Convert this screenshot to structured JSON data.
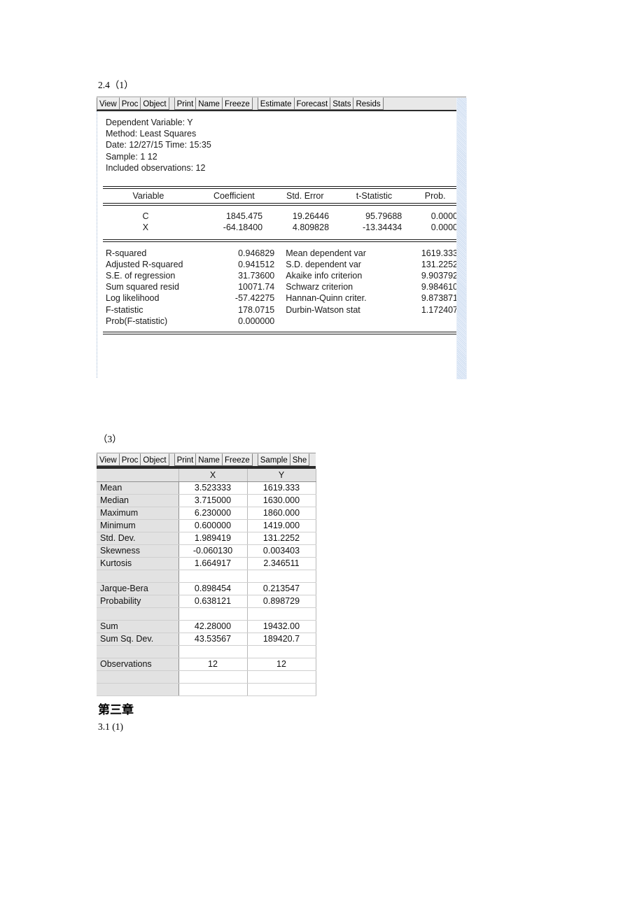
{
  "document": {
    "section_1_label": "2.4（1）",
    "section_3_label": "（3）",
    "chapter_heading": "第三章",
    "next_problem_label": "3.1 (1)"
  },
  "regression_window": {
    "toolbar": {
      "groups": [
        {
          "buttons": [
            "View",
            "Proc",
            "Object"
          ]
        },
        {
          "buttons": [
            "Print",
            "Name",
            "Freeze"
          ]
        },
        {
          "buttons": [
            "Estimate",
            "Forecast",
            "Stats",
            "Resids"
          ]
        }
      ]
    },
    "header_lines": [
      "Dependent Variable: Y",
      "Method: Least Squares",
      "Date: 12/27/15   Time: 15:35",
      "Sample: 1 12",
      "Included observations: 12"
    ],
    "coefficient_table": {
      "columns": [
        "Variable",
        "Coefficient",
        "Std. Error",
        "t-Statistic",
        "Prob."
      ],
      "rows": [
        {
          "variable": "C",
          "coefficient": "1845.475",
          "std_error": "19.26446",
          "t_statistic": "95.79688",
          "prob": "0.0000"
        },
        {
          "variable": "X",
          "coefficient": "-64.18400",
          "std_error": "4.809828",
          "t_statistic": "-13.34434",
          "prob": "0.0000"
        }
      ]
    },
    "summary_stats": [
      {
        "label_left": "R-squared",
        "value_left": "0.946829",
        "label_right": "Mean dependent var",
        "value_right": "1619.333"
      },
      {
        "label_left": "Adjusted R-squared",
        "value_left": "0.941512",
        "label_right": "S.D. dependent var",
        "value_right": "131.2252"
      },
      {
        "label_left": "S.E. of regression",
        "value_left": "31.73600",
        "label_right": "Akaike info criterion",
        "value_right": "9.903792"
      },
      {
        "label_left": "Sum squared resid",
        "value_left": "10071.74",
        "label_right": "Schwarz criterion",
        "value_right": "9.984610"
      },
      {
        "label_left": "Log likelihood",
        "value_left": "-57.42275",
        "label_right": "Hannan-Quinn criter.",
        "value_right": "9.873871"
      },
      {
        "label_left": "F-statistic",
        "value_left": "178.0715",
        "label_right": "Durbin-Watson stat",
        "value_right": "1.172407"
      },
      {
        "label_left": "Prob(F-statistic)",
        "value_left": "0.000000",
        "label_right": "",
        "value_right": ""
      }
    ]
  },
  "descriptive_window": {
    "toolbar": {
      "groups": [
        {
          "buttons": [
            "View",
            "Proc",
            "Object"
          ]
        },
        {
          "buttons": [
            "Print",
            "Name",
            "Freeze"
          ]
        },
        {
          "buttons": [
            "Sample",
            "She"
          ]
        }
      ]
    },
    "table": {
      "columns": [
        "",
        "X",
        "Y"
      ],
      "rows": [
        {
          "label": "Mean",
          "x": "3.523333",
          "y": "1619.333",
          "blank": false
        },
        {
          "label": "Median",
          "x": "3.715000",
          "y": "1630.000",
          "blank": false
        },
        {
          "label": "Maximum",
          "x": "6.230000",
          "y": "1860.000",
          "blank": false
        },
        {
          "label": "Minimum",
          "x": "0.600000",
          "y": "1419.000",
          "blank": false
        },
        {
          "label": "Std. Dev.",
          "x": "1.989419",
          "y": "131.2252",
          "blank": false
        },
        {
          "label": "Skewness",
          "x": "-0.060130",
          "y": "0.003403",
          "blank": false
        },
        {
          "label": "Kurtosis",
          "x": "1.664917",
          "y": "2.346511",
          "blank": false
        },
        {
          "label": "",
          "x": "",
          "y": "",
          "blank": true
        },
        {
          "label": "Jarque-Bera",
          "x": "0.898454",
          "y": "0.213547",
          "blank": false
        },
        {
          "label": "Probability",
          "x": "0.638121",
          "y": "0.898729",
          "blank": false
        },
        {
          "label": "",
          "x": "",
          "y": "",
          "blank": true
        },
        {
          "label": "Sum",
          "x": "42.28000",
          "y": "19432.00",
          "blank": false
        },
        {
          "label": "Sum Sq. Dev.",
          "x": "43.53567",
          "y": "189420.7",
          "blank": false
        },
        {
          "label": "",
          "x": "",
          "y": "",
          "blank": true
        },
        {
          "label": "Observations",
          "x": "12",
          "y": "12",
          "blank": false
        },
        {
          "label": "",
          "x": "",
          "y": "",
          "blank": true
        },
        {
          "label": "",
          "x": "",
          "y": "",
          "blank": true
        }
      ]
    }
  },
  "colors": {
    "scrollbar_track": "#cddcf0",
    "toolbar_face": "#e8e8e8",
    "cell_label_bg": "#e2e2e2",
    "rule": "#1a1a1a"
  }
}
